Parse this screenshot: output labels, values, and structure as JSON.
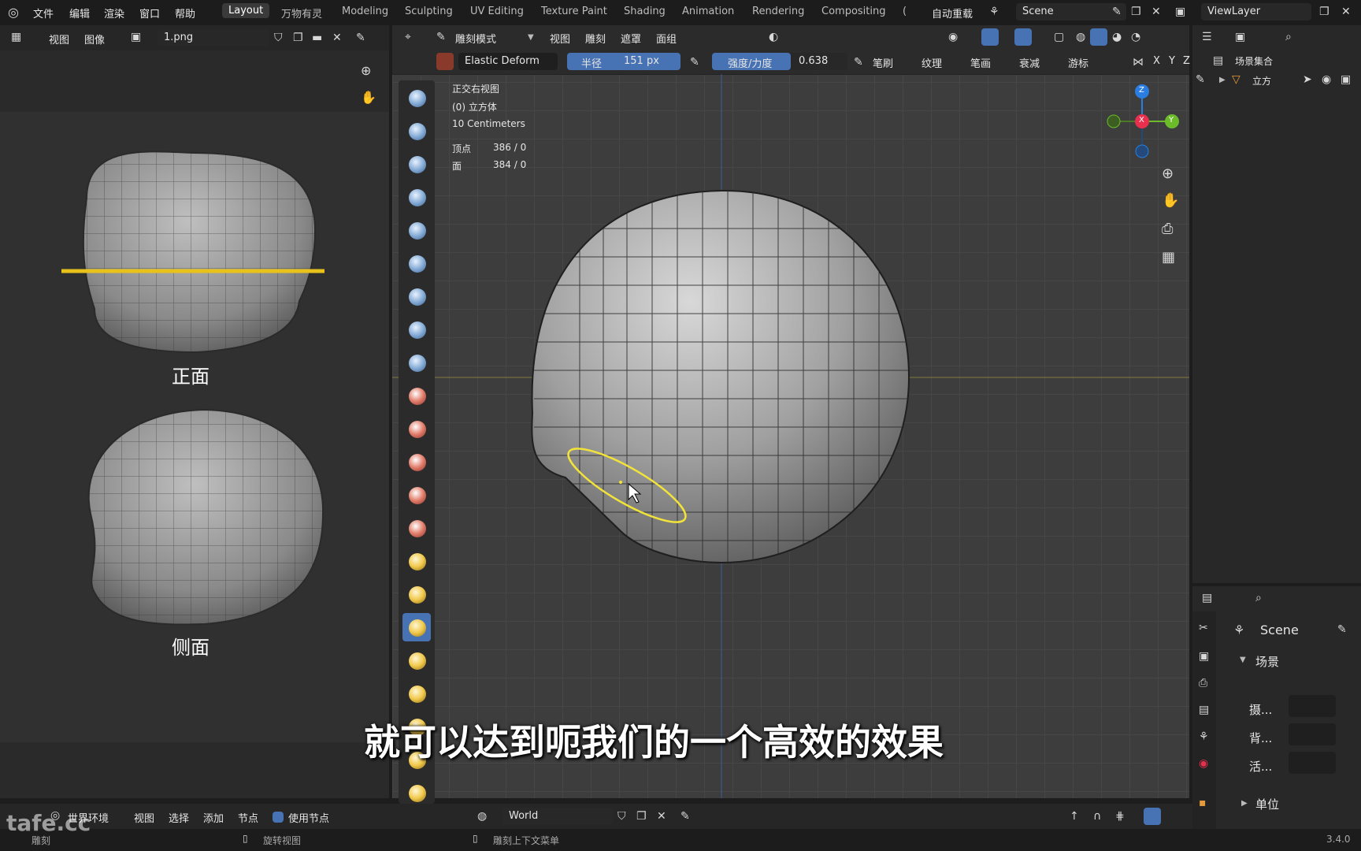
{
  "topbar": {
    "menus": [
      "文件",
      "编辑",
      "渲染",
      "窗口",
      "帮助"
    ],
    "workspaces": [
      "Layout",
      "万物有灵",
      "Modeling",
      "Sculpting",
      "UV Editing",
      "Texture Paint",
      "Shading",
      "Animation",
      "Rendering",
      "Compositing",
      "("
    ],
    "active_workspace": "Layout",
    "autoreload": "自动重载",
    "scene": "Scene",
    "view_layer": "ViewLayer"
  },
  "image_editor": {
    "menus": [
      "视图",
      "图像"
    ],
    "image_name": "1.png",
    "label_front": "正面",
    "label_side": "侧面"
  },
  "viewport": {
    "mode": "雕刻模式",
    "menus": [
      "视图",
      "雕刻",
      "遮罩",
      "面组"
    ],
    "brush_name": "Elastic Deform",
    "radius_label": "半径",
    "radius_value": "151 px",
    "strength_label": "强度/力度",
    "strength_value": "0.638",
    "options": [
      "笔刷",
      "纹理",
      "笔画",
      "衰减",
      "游标"
    ],
    "axes": [
      "X",
      "Y",
      "Z"
    ],
    "overlay_info": {
      "view_name": "正交右视图",
      "object": "(0) 立方体",
      "scale": "10 Centimeters",
      "vertices_label": "顶点",
      "vertices_value": "386 / 0",
      "faces_label": "面",
      "faces_value": "384 / 0"
    },
    "gizmo_axes": [
      "Z",
      "X",
      "Y"
    ]
  },
  "subtitle": "就可以达到呃我们的一个高效的效果",
  "outliner": {
    "collection": "场景集合",
    "object": "立方"
  },
  "properties": {
    "title": "Scene",
    "section_scene": "场景",
    "row_camera": "摄...",
    "row_background": "背...",
    "row_active": "活...",
    "section_units": "单位"
  },
  "node_bar": {
    "world_env": "世界环境",
    "menus": [
      "视图",
      "选择",
      "添加",
      "节点"
    ],
    "use_nodes": "使用节点",
    "world": "World"
  },
  "statusbar": {
    "left": "雕刻",
    "mid": "旋转视图",
    "right": "雕刻上下文菜单",
    "version": "3.4.0"
  },
  "watermark": "tafe.cc",
  "colors": {
    "accent_blue": "#4772b3",
    "brush_circle": "#f1e33a",
    "guide_line": "#e8c21b",
    "axis_z": "#2a7de1",
    "axis_x": "#e8304e",
    "axis_y": "#6cbb2a"
  }
}
